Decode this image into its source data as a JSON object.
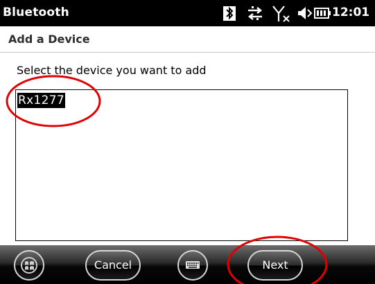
{
  "titlebar": {
    "title": "Bluetooth",
    "time": "12:01",
    "icons": [
      "bluetooth-icon",
      "data-transfer-icon",
      "signal-off-icon",
      "volume-muted-icon",
      "battery-icon"
    ]
  },
  "subheader": {
    "title": "Add a Device"
  },
  "main": {
    "instruction": "Select the device you want to add",
    "devices": [
      "Rx1277"
    ],
    "selected_device": "Rx1277"
  },
  "bottombar": {
    "start_icon": "windows-start-icon",
    "cancel_label": "Cancel",
    "keyboard_icon": "keyboard-icon",
    "next_label": "Next"
  },
  "colors": {
    "titlebar_bg": "#000000",
    "selection_bg": "#000000",
    "annotation": "#e00000"
  }
}
